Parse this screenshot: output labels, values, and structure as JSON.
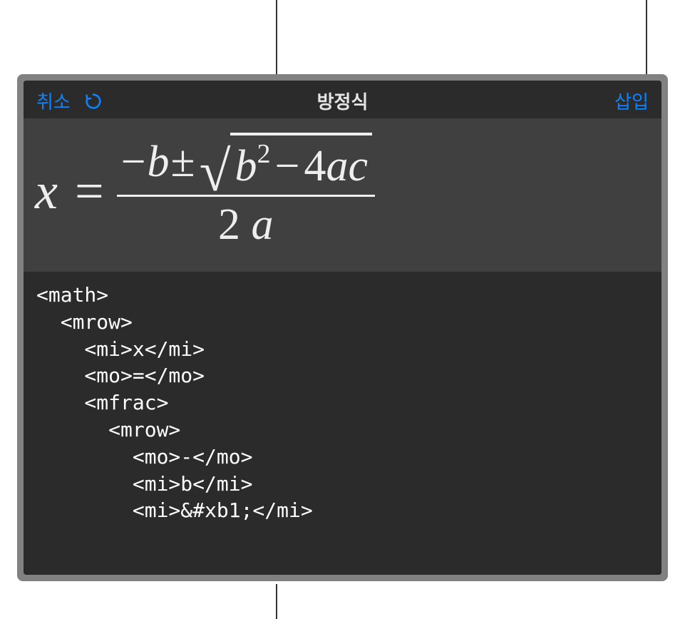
{
  "toolbar": {
    "cancel_label": "취소",
    "title": "방정식",
    "insert_label": "삽입"
  },
  "equation_preview": {
    "x": "x",
    "equals": "=",
    "minus": "−",
    "b": "b",
    "plusminus": "±",
    "sqrt": "√",
    "b2_b": "b",
    "b2_exp": "2",
    "minus2": "−",
    "four": "4",
    "a": "a",
    "c": "c",
    "two": "2",
    "a2": "a"
  },
  "code_lines": [
    "<math>",
    "  <mrow>",
    "    <mi>x</mi>",
    "    <mo>=</mo>",
    "    <mfrac>",
    "      <mrow>",
    "        <mo>-</mo>",
    "        <mi>b</mi>",
    "        <mi>&#xb1;</mi>"
  ]
}
